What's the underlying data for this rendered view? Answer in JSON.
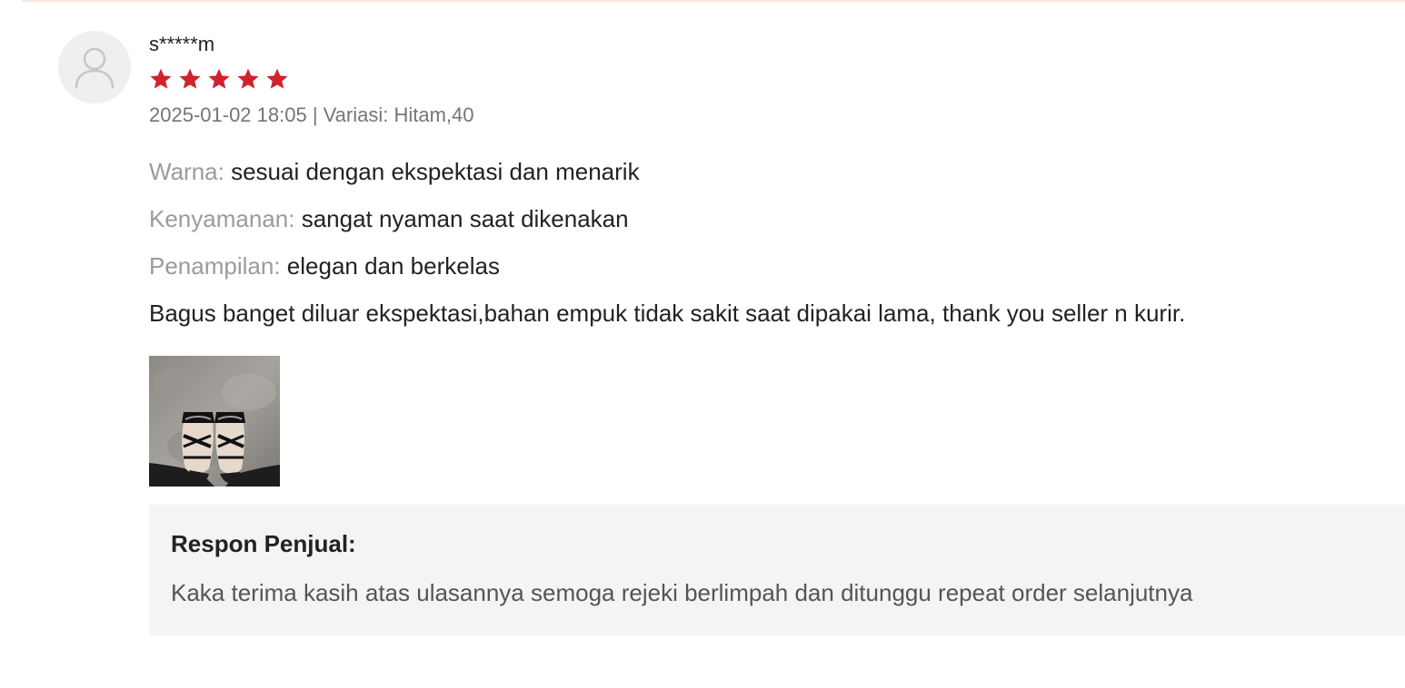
{
  "review": {
    "username": "s*****m",
    "rating": 5,
    "rating_max": 5,
    "meta": "2025-01-02 18:05 | Variasi: Hitam,40",
    "attributes": [
      {
        "label": "Warna:",
        "value": "sesuai dengan ekspektasi dan menarik"
      },
      {
        "label": "Kenyamanan:",
        "value": "sangat nyaman saat dikenakan"
      },
      {
        "label": "Penampilan:",
        "value": "elegan dan berkelas"
      }
    ],
    "comment": "Bagus banget diluar ekspektasi,bahan empuk tidak sakit saat dipakai lama, thank you seller n kurir.",
    "photo_icon": "review-photo-sandals",
    "seller_response": {
      "title": "Respon Penjual:",
      "text": "Kaka terima kasih atas ulasannya semoga rejeki berlimpah dan ditunggu repeat order selanjutnya"
    }
  },
  "colors": {
    "star": "#d0232e",
    "divider": "#fbe7e1",
    "response_bg": "#f4f4f4"
  }
}
